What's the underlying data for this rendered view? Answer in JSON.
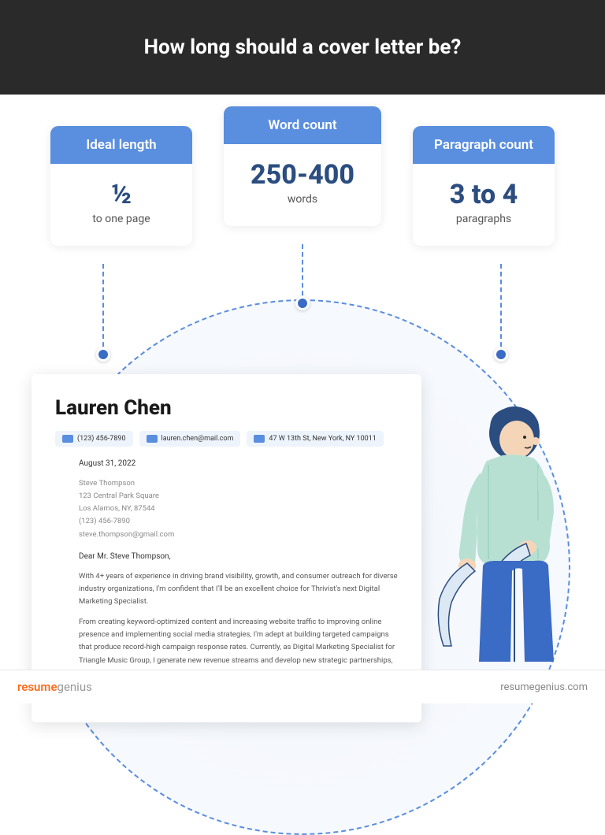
{
  "header": {
    "title": "How long should a cover letter be?"
  },
  "cards": [
    {
      "label": "Ideal length",
      "big": "½",
      "sub": "to one page"
    },
    {
      "label": "Word count",
      "big": "250-400",
      "sub": "words"
    },
    {
      "label": "Paragraph count",
      "big": "3 to 4",
      "sub": "paragraphs"
    }
  ],
  "letter": {
    "name": "Lauren Chen",
    "contacts": [
      {
        "text": "(123) 456-7890"
      },
      {
        "text": "lauren.chen@mail.com"
      },
      {
        "text": "47 W 13th St, New York, NY 10011"
      }
    ],
    "date": "August 31, 2022",
    "recipient": {
      "name": "Steve Thompson",
      "street": "123 Central Park Square",
      "city": "Los Alamos, NY, 87544",
      "phone": "(123) 456-7890",
      "email": "steve.thompson@gmail.com"
    },
    "greeting": "Dear Mr. Steve Thompson,",
    "para1": "With 4+ years of experience in driving brand visibility, growth, and consumer outreach for diverse industry organizations, I'm confident that I'll be an excellent choice for Thrivist's next Digital Marketing Specialist.",
    "para2": "From creating keyword-optimized content and increasing website traffic to improving online presence and implementing social media strategies, I'm adept at building targeted campaigns that produce record-high campaign response rates. Currently, as Digital Marketing Specialist for Triangle Music Group, I generate new revenue streams and develop new strategic partnerships, social engagements, and advertising opportunities. Please consider the following highlights of my career:und the job"
  },
  "footer": {
    "logo_part1": "resume",
    "logo_part2": "genius",
    "site": "resumegenius.com"
  }
}
